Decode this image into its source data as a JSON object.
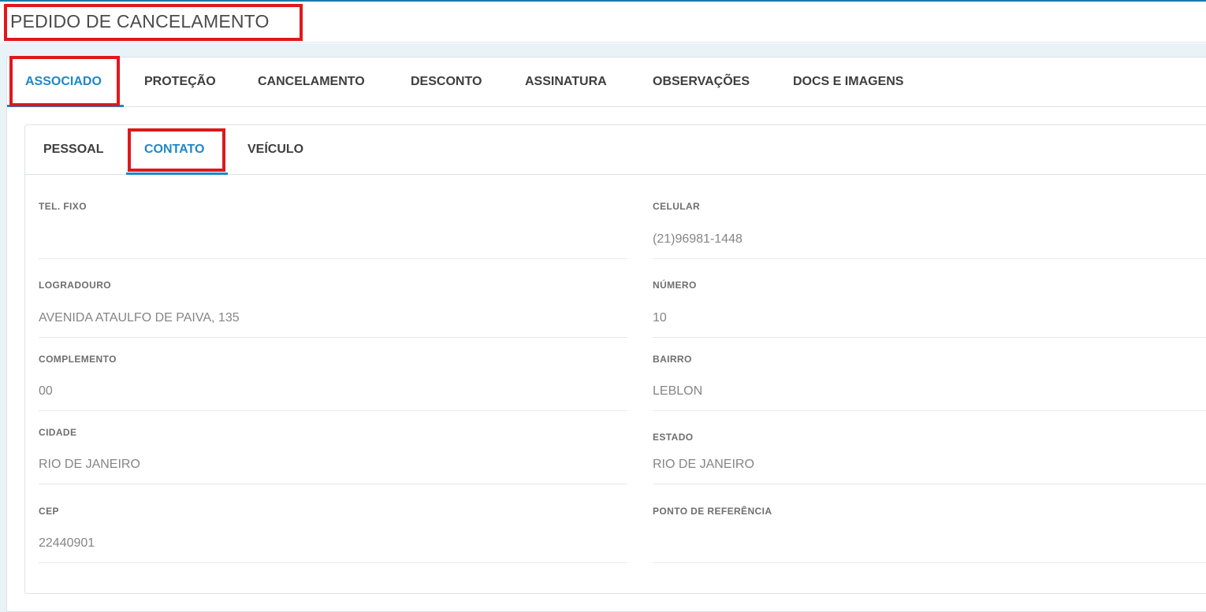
{
  "header": {
    "title": "PEDIDO DE CANCELAMENTO"
  },
  "main_tabs": [
    {
      "label": "ASSOCIADO",
      "active": true
    },
    {
      "label": "PROTEÇÃO",
      "active": false
    },
    {
      "label": "CANCELAMENTO",
      "active": false
    },
    {
      "label": "DESCONTO",
      "active": false
    },
    {
      "label": "ASSINATURA",
      "active": false
    },
    {
      "label": "OBSERVAÇÕES",
      "active": false
    },
    {
      "label": "DOCS E IMAGENS",
      "active": false
    }
  ],
  "sub_tabs": [
    {
      "label": "PESSOAL",
      "active": false
    },
    {
      "label": "CONTATO",
      "active": true
    },
    {
      "label": "VEÍCULO",
      "active": false
    }
  ],
  "fields": {
    "tel_fixo": {
      "label": "TEL. FIXO",
      "value": ""
    },
    "celular": {
      "label": "CELULAR",
      "value": "(21)96981-1448"
    },
    "logradouro": {
      "label": "LOGRADOURO",
      "value": "AVENIDA ATAULFO DE PAIVA, 135"
    },
    "numero": {
      "label": "NÚMERO",
      "value": "10"
    },
    "complemento": {
      "label": "COMPLEMENTO",
      "value": "00"
    },
    "bairro": {
      "label": "BAIRRO",
      "value": "LEBLON"
    },
    "cidade": {
      "label": "CIDADE",
      "value": "RIO DE JANEIRO"
    },
    "estado": {
      "label": "ESTADO",
      "value": "RIO DE JANEIRO"
    },
    "cep": {
      "label": "CEP",
      "value": "22440901"
    },
    "ponto_referencia": {
      "label": "PONTO DE REFERÊNCIA",
      "value": ""
    }
  },
  "colors": {
    "accent": "#1e88c7",
    "highlight": "#e0181b",
    "background_band": "#e9f2f7"
  }
}
